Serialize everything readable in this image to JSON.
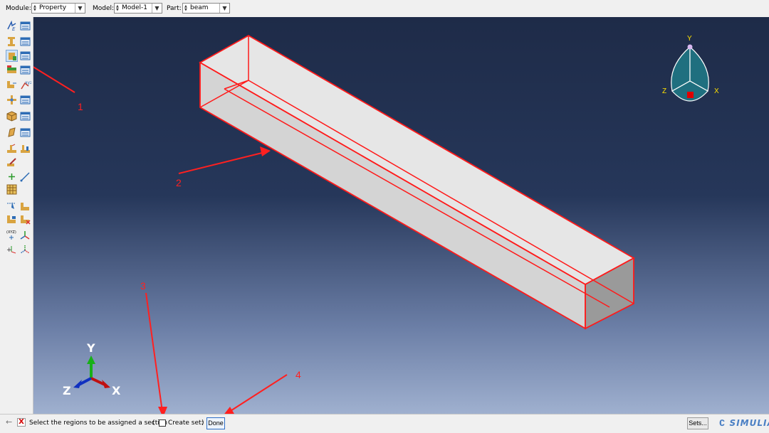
{
  "context_bar": {
    "module_label": "Module:",
    "module_value": "Property",
    "model_label": "Model:",
    "model_value": "Model-1",
    "part_label": "Part:",
    "part_value": "beam"
  },
  "toolbox": {
    "tools": [
      "create-material-icon",
      "material-manager-icon",
      "create-section-icon",
      "section-manager-icon",
      "assign-section-icon",
      "section-assignment-manager-icon",
      "assign-beam-orientation-icon",
      "assign-material-orientation-icon",
      "create-profile-icon",
      "profile-manager-icon",
      "create-composite-layup-icon",
      "composite-layup-manager-icon",
      "create-skin-icon",
      "skin-manager-icon",
      "create-stringer-icon",
      "stringer-manager-icon",
      "special-icon",
      "datum-point-icon",
      "datum-axis-icon",
      "partition-icon",
      "query-icon",
      "datum-csys-icon",
      "transform-icon"
    ]
  },
  "annotations": {
    "label_1": "1",
    "label_2": "2",
    "label_3": "3",
    "label_4": "4",
    "color": "#ff2020"
  },
  "triad": {
    "x": "X",
    "y": "Y",
    "z": "Z"
  },
  "view_cube": {
    "x": "X",
    "y": "Y",
    "z": "Z"
  },
  "prompt": {
    "message": "Select the regions to be assigned a section",
    "open_paren": "(",
    "create_set_label": "Create set:",
    "close_paren": ")",
    "done_label": "Done",
    "sets_label": "Sets..."
  },
  "brand": {
    "logo_text": "SIMULIA",
    "logo_color": "#4a7fc4"
  },
  "colors": {
    "edge_color": "#ff1a1a",
    "viewport_top": "#1e2b48",
    "viewport_bottom": "#9fb0cf"
  }
}
